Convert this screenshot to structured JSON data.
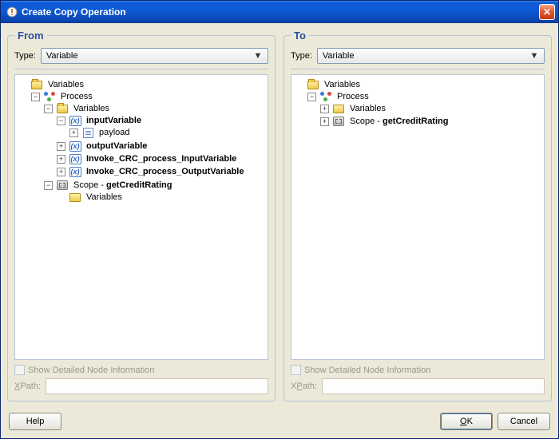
{
  "window": {
    "title": "Create Copy Operation"
  },
  "from": {
    "legend": "From",
    "type_label": "Type:",
    "type_value": "Variable",
    "tree": {
      "root": "Variables",
      "process": "Process",
      "variables_label": "Variables",
      "inputVariable": "inputVariable",
      "payload": "payload",
      "outputVariable": "outputVariable",
      "invoke_in": "Invoke_CRC_process_InputVariable",
      "invoke_out": "Invoke_CRC_process_OutputVariable",
      "scope_prefix": "Scope - ",
      "scope_name": "getCreditRating",
      "scope_vars": "Variables"
    },
    "show_detail": "Show Detailed Node Information",
    "xpath_label": "XPath:"
  },
  "to": {
    "legend": "To",
    "type_label": "Type:",
    "type_value": "Variable",
    "tree": {
      "root": "Variables",
      "process": "Process",
      "variables_label": "Variables",
      "scope_prefix": "Scope - ",
      "scope_name": "getCreditRating"
    },
    "show_detail": "Show Detailed Node Information",
    "xpath_label": "XPath:"
  },
  "buttons": {
    "help": "Help",
    "ok": "OK",
    "cancel": "Cancel"
  }
}
